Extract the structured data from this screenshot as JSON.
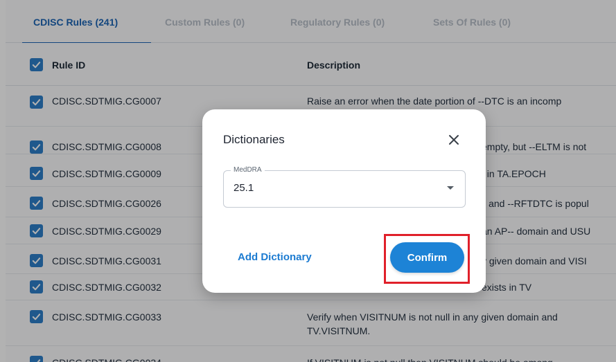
{
  "tabs": [
    {
      "label": "CDISC Rules (241)"
    },
    {
      "label": "Custom Rules (0)"
    },
    {
      "label": "Regulatory Rules (0)"
    },
    {
      "label": "Sets Of Rules (0)"
    }
  ],
  "table": {
    "headers": {
      "rule_id": "Rule ID",
      "description": "Description"
    },
    "rows": [
      {
        "rule_id": "CDISC.SDTMIG.CG0007",
        "description": "Raise an error when the date portion of --DTC is an incomp",
        "description_line2": ""
      },
      {
        "rule_id": "CDISC.SDTMIG.CG0008",
        "description": "empty, but --ELTM is not",
        "description_line2": ""
      },
      {
        "rule_id": "CDISC.SDTMIG.CG0009",
        "description": "t in TA.EPOCH",
        "description_line2": ""
      },
      {
        "rule_id": "CDISC.SDTMIG.CG0026",
        "description": "ll and --RFTDTC is popul",
        "description_line2": ""
      },
      {
        "rule_id": "CDISC.SDTMIG.CG0029",
        "description": "an AP-- domain and USU",
        "description_line2": ""
      },
      {
        "rule_id": "CDISC.SDTMIG.CG0031",
        "description": "y given domain and VISI",
        "description_line2": ""
      },
      {
        "rule_id": "CDISC.SDTMIG.CG0032",
        "description": "exists in TV",
        "description_line2": ""
      },
      {
        "rule_id": "CDISC.SDTMIG.CG0033",
        "description": "Verify when VISITNUM is not null in any given domain and",
        "description_line2": "TV.VISITNUM."
      },
      {
        "rule_id": "CDISC.SDTMIG.CG0034",
        "description": "If VISITNUM is not null then VISITNUM should be among",
        "description_line2": ""
      }
    ]
  },
  "dialog": {
    "title": "Dictionaries",
    "field_label": "MedDRA",
    "field_value": "25.1",
    "add_label": "Add Dictionary",
    "confirm_label": "Confirm"
  },
  "icons": {
    "close": "close-icon",
    "dropdown": "caret-down-icon",
    "checkbox": "checkmark-icon"
  },
  "colors": {
    "accent": "#1c65b5",
    "confirm": "#1d83d6",
    "highlight": "#e0202a",
    "checkbox": "#2d7ec9"
  }
}
